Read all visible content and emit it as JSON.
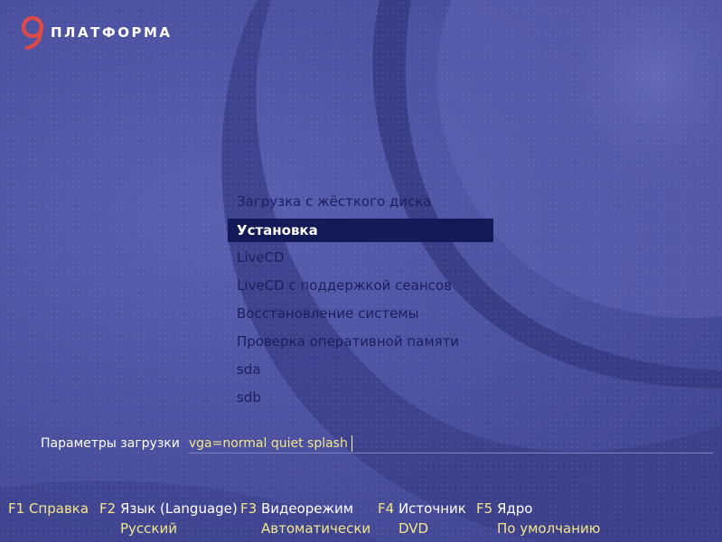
{
  "logo": {
    "name": "ПЛАТФОРМА",
    "icon": "platform-9-logo"
  },
  "menu": {
    "selected_index": 1,
    "items": [
      {
        "label": "Загрузка с жёсткого диска"
      },
      {
        "label": "Установка"
      },
      {
        "label": "LiveCD"
      },
      {
        "label": "LiveCD с поддержкой сеансов"
      },
      {
        "label": "Восстановление системы"
      },
      {
        "label": "Проверка оперативной памяти"
      },
      {
        "label": "sda"
      },
      {
        "label": "sdb"
      }
    ]
  },
  "boot_params": {
    "label": "Параметры загрузки",
    "value": "vga=normal quiet splash"
  },
  "function_keys": [
    {
      "key": "F1",
      "label": "Справка",
      "value": ""
    },
    {
      "key": "F2",
      "label": "Язык (Language)",
      "value": "Русский"
    },
    {
      "key": "F3",
      "label": "Видеорежим",
      "value": "Автоматически"
    },
    {
      "key": "F4",
      "label": "Источник",
      "value": "DVD"
    },
    {
      "key": "F5",
      "label": "Ядро",
      "value": "По умолчанию"
    }
  ],
  "colors": {
    "background": "#4a4f9a",
    "selection": "#141a58",
    "accent_yellow": "#f3e58a",
    "menu_text": "#1c1f5e"
  }
}
